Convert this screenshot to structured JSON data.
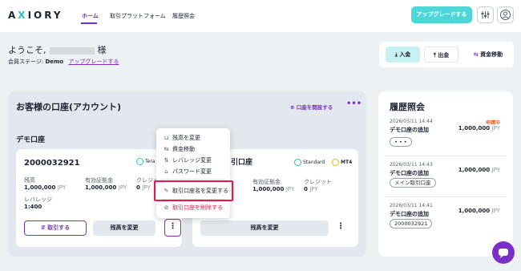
{
  "header": {
    "logo_a": "A",
    "logo_x": "X",
    "logo_rest": "IORY",
    "nav": [
      "ホーム",
      "取引プラットフォーム",
      "履歴照会"
    ],
    "upgrade": "アップグレードする"
  },
  "welcome": {
    "greeting": "ようこそ,",
    "honorific": "様",
    "stage_label": "会員ステージ:",
    "stage_value": "Demo",
    "upgrade_link": "アップグレードする"
  },
  "actions": {
    "deposit": "入金",
    "withdraw": "出金",
    "transfer": "資金移動"
  },
  "accounts": {
    "title": "お客様の口座(アカウント)",
    "open_link": "口座を開設する",
    "demo_title": "デモ口座",
    "card1": {
      "number": "2000032921",
      "platform": "Tera",
      "balance_label": "残高",
      "balance": "1,000,000",
      "margin_label": "有効証拠金",
      "margin": "1,000,000",
      "credit_label": "クレジット",
      "credit": "0",
      "leverage_label": "レバレッジ",
      "leverage": "1:400",
      "unit": "JPY",
      "trade_btn": "取引する",
      "change_btn": "残高を変更"
    },
    "card2": {
      "number_partial": "引口座",
      "type": "Standard",
      "platform": "MT4",
      "margin_label": "有効証拠金",
      "margin": "1,000,000",
      "credit_label": "クレジット",
      "credit": "0",
      "unit": "JPY",
      "change_btn": "残高を変更"
    }
  },
  "menu": {
    "items": [
      "残高を変更",
      "資金移動",
      "レバレッジ変更",
      "パスワード変更",
      "取引口座名を変更する",
      "取引口座を削除する"
    ]
  },
  "history": {
    "title": "履歴照会",
    "entries": [
      {
        "date": "2026/03/11 14:44",
        "name": "デモ口座の追加",
        "amount": "1,000,000",
        "unit": "JPY",
        "status": "申請中",
        "tag": "• • •"
      },
      {
        "date": "2026/03/11 14:43",
        "name": "デモ口座の追加",
        "amount": "1,000,000",
        "unit": "JPY",
        "tag": "メイン取引口座"
      },
      {
        "date": "2026/03/11 14:41",
        "name": "デモ口座の追加",
        "amount": "1,000,000",
        "unit": "JPY",
        "tag": "2000032921"
      }
    ]
  },
  "colors": {
    "accent": "#7b2fc9",
    "teal": "#4fd6d9",
    "danger": "#e4184c"
  }
}
